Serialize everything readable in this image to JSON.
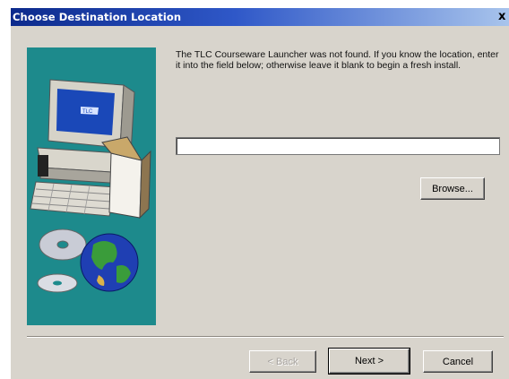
{
  "window": {
    "title": "Choose Destination Location",
    "close_label": "x"
  },
  "art": {
    "icons": [
      "computer-monitor-icon",
      "desktop-tower-icon",
      "keyboard-icon",
      "open-box-icon",
      "cd-disc-icon",
      "globe-icon"
    ],
    "monitor_screen_label": "TLC"
  },
  "message": {
    "text": "The TLC Courseware Launcher was not found. If you know the location, enter it into the field below; otherwise leave it blank to begin a fresh install."
  },
  "path_field": {
    "value": ""
  },
  "buttons": {
    "browse": "Browse...",
    "back": "< Back",
    "next": "Next >",
    "cancel": "Cancel"
  },
  "colors": {
    "title_bar_start": "#0c2a8c",
    "title_bar_end": "#a8c4ec",
    "dialog_background": "#d8d4cc",
    "art_background": "#1d8a8c"
  }
}
